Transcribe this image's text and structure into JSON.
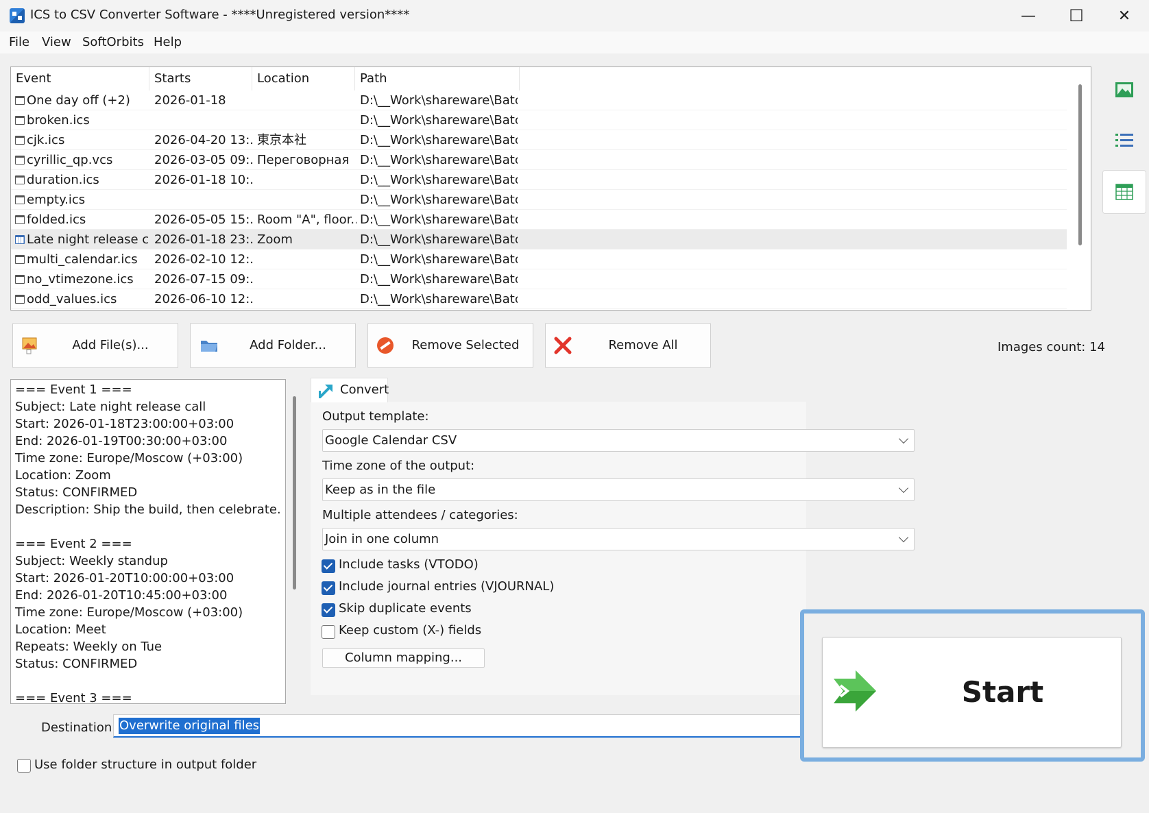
{
  "window": {
    "title": "ICS to CSV Converter Software - ****Unregistered version****",
    "minimize": "—",
    "maximize": "☐",
    "close": "✕"
  },
  "menu": [
    "File",
    "View",
    "SoftOrbits",
    "Help"
  ],
  "file_list": {
    "columns": [
      "Event",
      "Starts",
      "Location",
      "Path"
    ],
    "rows": [
      {
        "event": "One day off (+2)",
        "starts": "2026-01-18",
        "location": "",
        "path": "D:\\__Work\\shareware\\Batch...",
        "icon": "file-icon"
      },
      {
        "event": "broken.ics",
        "starts": "",
        "location": "",
        "path": "D:\\__Work\\shareware\\Batch...",
        "icon": "file-icon"
      },
      {
        "event": "cjk.ics",
        "starts": "2026-04-20 13:...",
        "location": "東京本社",
        "path": "D:\\__Work\\shareware\\Batch...",
        "icon": "file-icon"
      },
      {
        "event": "cyrillic_qp.vcs",
        "starts": "2026-03-05 09:...",
        "location": "Переговорная",
        "path": "D:\\__Work\\shareware\\Batch...",
        "icon": "file-icon"
      },
      {
        "event": "duration.ics",
        "starts": "2026-01-18 10:...",
        "location": "",
        "path": "D:\\__Work\\shareware\\Batch...",
        "icon": "file-icon"
      },
      {
        "event": "empty.ics",
        "starts": "",
        "location": "",
        "path": "D:\\__Work\\shareware\\Batch...",
        "icon": "file-icon"
      },
      {
        "event": "folded.ics",
        "starts": "2026-05-05 15:...",
        "location": "Room \"A\", floor...",
        "path": "D:\\__Work\\shareware\\Batch...",
        "icon": "file-icon"
      },
      {
        "event": "Late night release cal...",
        "starts": "2026-01-18 23:...",
        "location": "Zoom",
        "path": "D:\\__Work\\shareware\\Batch...",
        "icon": "calendar-file-icon",
        "selected": true
      },
      {
        "event": "multi_calendar.ics",
        "starts": "2026-02-10 12:...",
        "location": "",
        "path": "D:\\__Work\\shareware\\Batch...",
        "icon": "file-icon"
      },
      {
        "event": "no_vtimezone.ics",
        "starts": "2026-07-15 09:...",
        "location": "",
        "path": "D:\\__Work\\shareware\\Batch...",
        "icon": "file-icon"
      },
      {
        "event": "odd_values.ics",
        "starts": "2026-06-10 12:...",
        "location": "",
        "path": "D:\\__Work\\shareware\\Batch...",
        "icon": "file-icon"
      }
    ]
  },
  "toolbar": {
    "add_files": "Add File(s)...",
    "add_folder": "Add Folder...",
    "remove_selected": "Remove Selected",
    "remove_all": "Remove All",
    "images_count": "Images count: 14"
  },
  "sidebar_icons": [
    "image-icon",
    "list-view-icon",
    "table-view-icon"
  ],
  "log_lines": [
    "=== Event 1 ===",
    "Subject: Late night release call",
    "Start: 2026-01-18T23:00:00+03:00",
    "End: 2026-01-19T00:30:00+03:00",
    "Time zone: Europe/Moscow (+03:00)",
    "Location: Zoom",
    "Status: CONFIRMED",
    "Description: Ship the build, then celebrate.",
    "",
    "=== Event 2 ===",
    "Subject: Weekly standup",
    "Start: 2026-01-20T10:00:00+03:00",
    "End: 2026-01-20T10:45:00+03:00",
    "Time zone: Europe/Moscow (+03:00)",
    "Location: Meet",
    "Repeats: Weekly on Tue",
    "Status: CONFIRMED",
    "",
    "=== Event 3 ==="
  ],
  "convert": {
    "tab_label": "Convert",
    "output_template_label": "Output template:",
    "output_template_value": "Google Calendar CSV",
    "timezone_label": "Time zone of the output:",
    "timezone_value": "Keep as in the file",
    "multi_label": "Multiple attendees / categories:",
    "multi_value": "Join in one column",
    "checkboxes": [
      {
        "label": "Include tasks (VTODO)",
        "checked": true
      },
      {
        "label": "Include journal entries (VJOURNAL)",
        "checked": true
      },
      {
        "label": "Skip duplicate events",
        "checked": true
      },
      {
        "label": "Keep custom (X-) fields",
        "checked": false
      }
    ],
    "column_mapping": "Column mapping..."
  },
  "destination": {
    "label": "Destination",
    "value": "Overwrite original files"
  },
  "folder_structure": {
    "label": "Use folder structure in output folder",
    "checked": false
  },
  "start_button": "Start",
  "colors": {
    "accent": "#1f6fd0",
    "start_highlight": "#7aaee0",
    "start_arrow": "#3aa53a"
  }
}
